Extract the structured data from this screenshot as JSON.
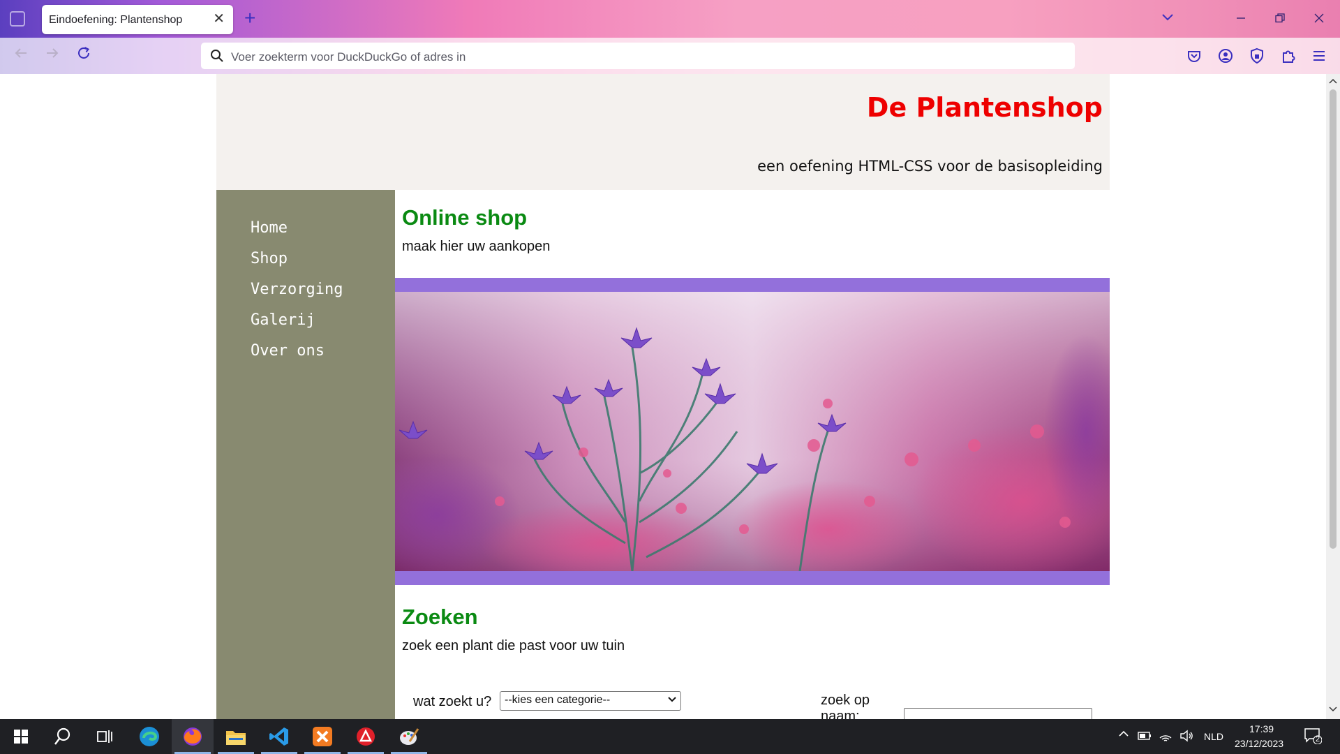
{
  "browser": {
    "tab_title": "Eindoefening: Plantenshop",
    "tab_close": "✕",
    "new_tab": "+",
    "address_placeholder": "Voer zoekterm voor DuckDuckGo of adres in"
  },
  "page": {
    "site_title": "De Plantenshop",
    "site_subtitle": "een oefening HTML-CSS voor de basisopleiding",
    "nav": [
      "Home",
      "Shop",
      "Verzorging",
      "Galerij",
      "Over ons"
    ],
    "section1_title": "Online shop",
    "section1_text": "maak hier uw aankopen",
    "section2_title": "Zoeken",
    "section2_text": "zoek een plant die past voor uw tuin",
    "category_label": "wat zoekt u?",
    "category_selected": "--kies een categorie--",
    "name_label_line1": "zoek op",
    "name_label_line2": "naam:"
  },
  "taskbar": {
    "language": "NLD",
    "time": "17:39",
    "date": "23/12/2023",
    "notification_count": "2"
  },
  "colors": {
    "title_red": "#ee0000",
    "heading_green": "#0a8a12",
    "sidebar": "#888a70",
    "banner_frame": "#9370db"
  }
}
